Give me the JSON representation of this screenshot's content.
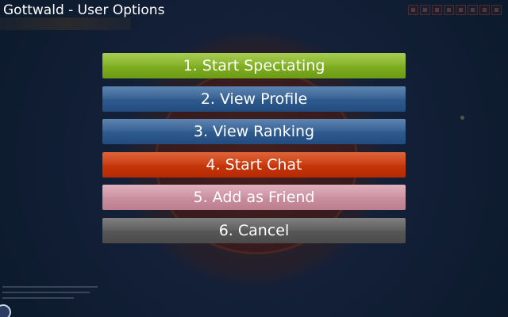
{
  "window": {
    "title": "Gottwald - User Options"
  },
  "menu": {
    "items": [
      {
        "label": "1. Start Spectating",
        "color": "#82b321"
      },
      {
        "label": "2. View Profile",
        "color": "#2e5b8f"
      },
      {
        "label": "3. View Ranking",
        "color": "#2e5b8f"
      },
      {
        "label": "4. Start Chat",
        "color": "#c73509"
      },
      {
        "label": "5. Add as Friend",
        "color": "#ca90a0"
      },
      {
        "label": "6. Cancel",
        "color": "#585858"
      }
    ]
  },
  "icons": {
    "top_right": [
      "window-icon",
      "window-icon",
      "window-icon",
      "window-icon",
      "window-icon",
      "window-icon",
      "window-icon",
      "window-icon"
    ],
    "bottom_left": "osu-logo-icon"
  }
}
